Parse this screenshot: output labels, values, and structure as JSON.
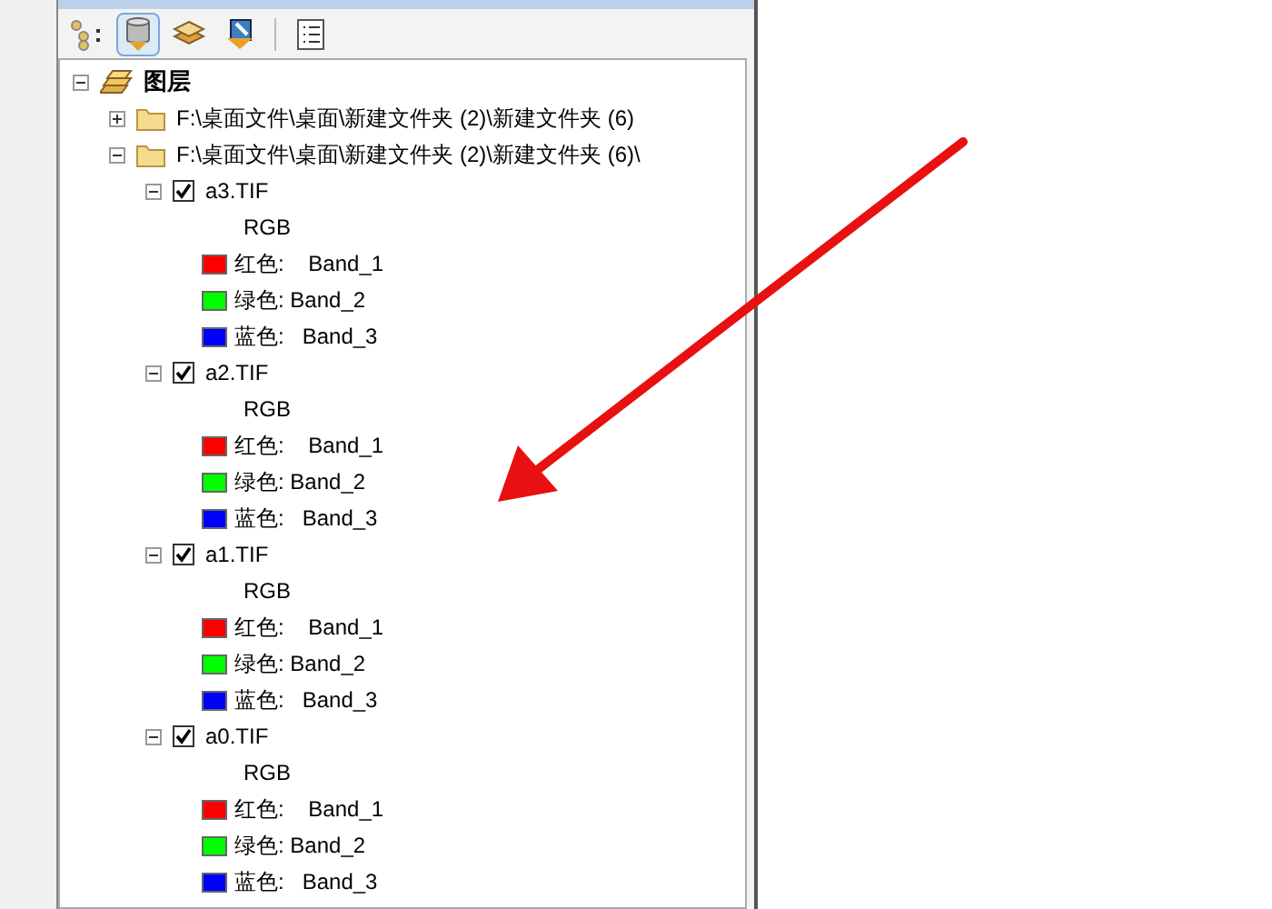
{
  "toolbar": {
    "buttons": [
      {
        "kind": "list-by-drawing-order",
        "selected": false
      },
      {
        "kind": "list-by-source",
        "selected": true
      },
      {
        "kind": "list-by-visibility",
        "selected": false
      },
      {
        "kind": "list-by-selection",
        "selected": false
      },
      {
        "kind": "options",
        "selected": false
      }
    ]
  },
  "tree": {
    "label": "图层",
    "expanded": true,
    "children": [
      {
        "label": "F:\\桌面文件\\桌面\\新建文件夹 (2)\\新建文件夹 (6)",
        "expanded": false
      },
      {
        "label": "F:\\桌面文件\\桌面\\新建文件夹 (2)\\新建文件夹 (6)\\",
        "expanded": true,
        "layers": [
          {
            "name": "a3.TIF",
            "checked": true,
            "expanded": true,
            "renderer": "RGB",
            "bands": [
              {
                "text": "红色:    Band_1",
                "color": "#ff0000"
              },
              {
                "text": "绿色: Band_2",
                "color": "#00ff00"
              },
              {
                "text": "蓝色:   Band_3",
                "color": "#0000ff"
              }
            ]
          },
          {
            "name": "a2.TIF",
            "checked": true,
            "expanded": true,
            "renderer": "RGB",
            "bands": [
              {
                "text": "红色:    Band_1",
                "color": "#ff0000"
              },
              {
                "text": "绿色: Band_2",
                "color": "#00ff00"
              },
              {
                "text": "蓝色:   Band_3",
                "color": "#0000ff"
              }
            ]
          },
          {
            "name": "a1.TIF",
            "checked": true,
            "expanded": true,
            "renderer": "RGB",
            "bands": [
              {
                "text": "红色:    Band_1",
                "color": "#ff0000"
              },
              {
                "text": "绿色: Band_2",
                "color": "#00ff00"
              },
              {
                "text": "蓝色:   Band_3",
                "color": "#0000ff"
              }
            ]
          },
          {
            "name": "a0.TIF",
            "checked": true,
            "expanded": true,
            "renderer": "RGB",
            "bands": [
              {
                "text": "红色:    Band_1",
                "color": "#ff0000"
              },
              {
                "text": "绿色: Band_2",
                "color": "#00ff00"
              },
              {
                "text": "蓝色:   Band_3",
                "color": "#0000ff"
              }
            ]
          }
        ]
      }
    ]
  }
}
